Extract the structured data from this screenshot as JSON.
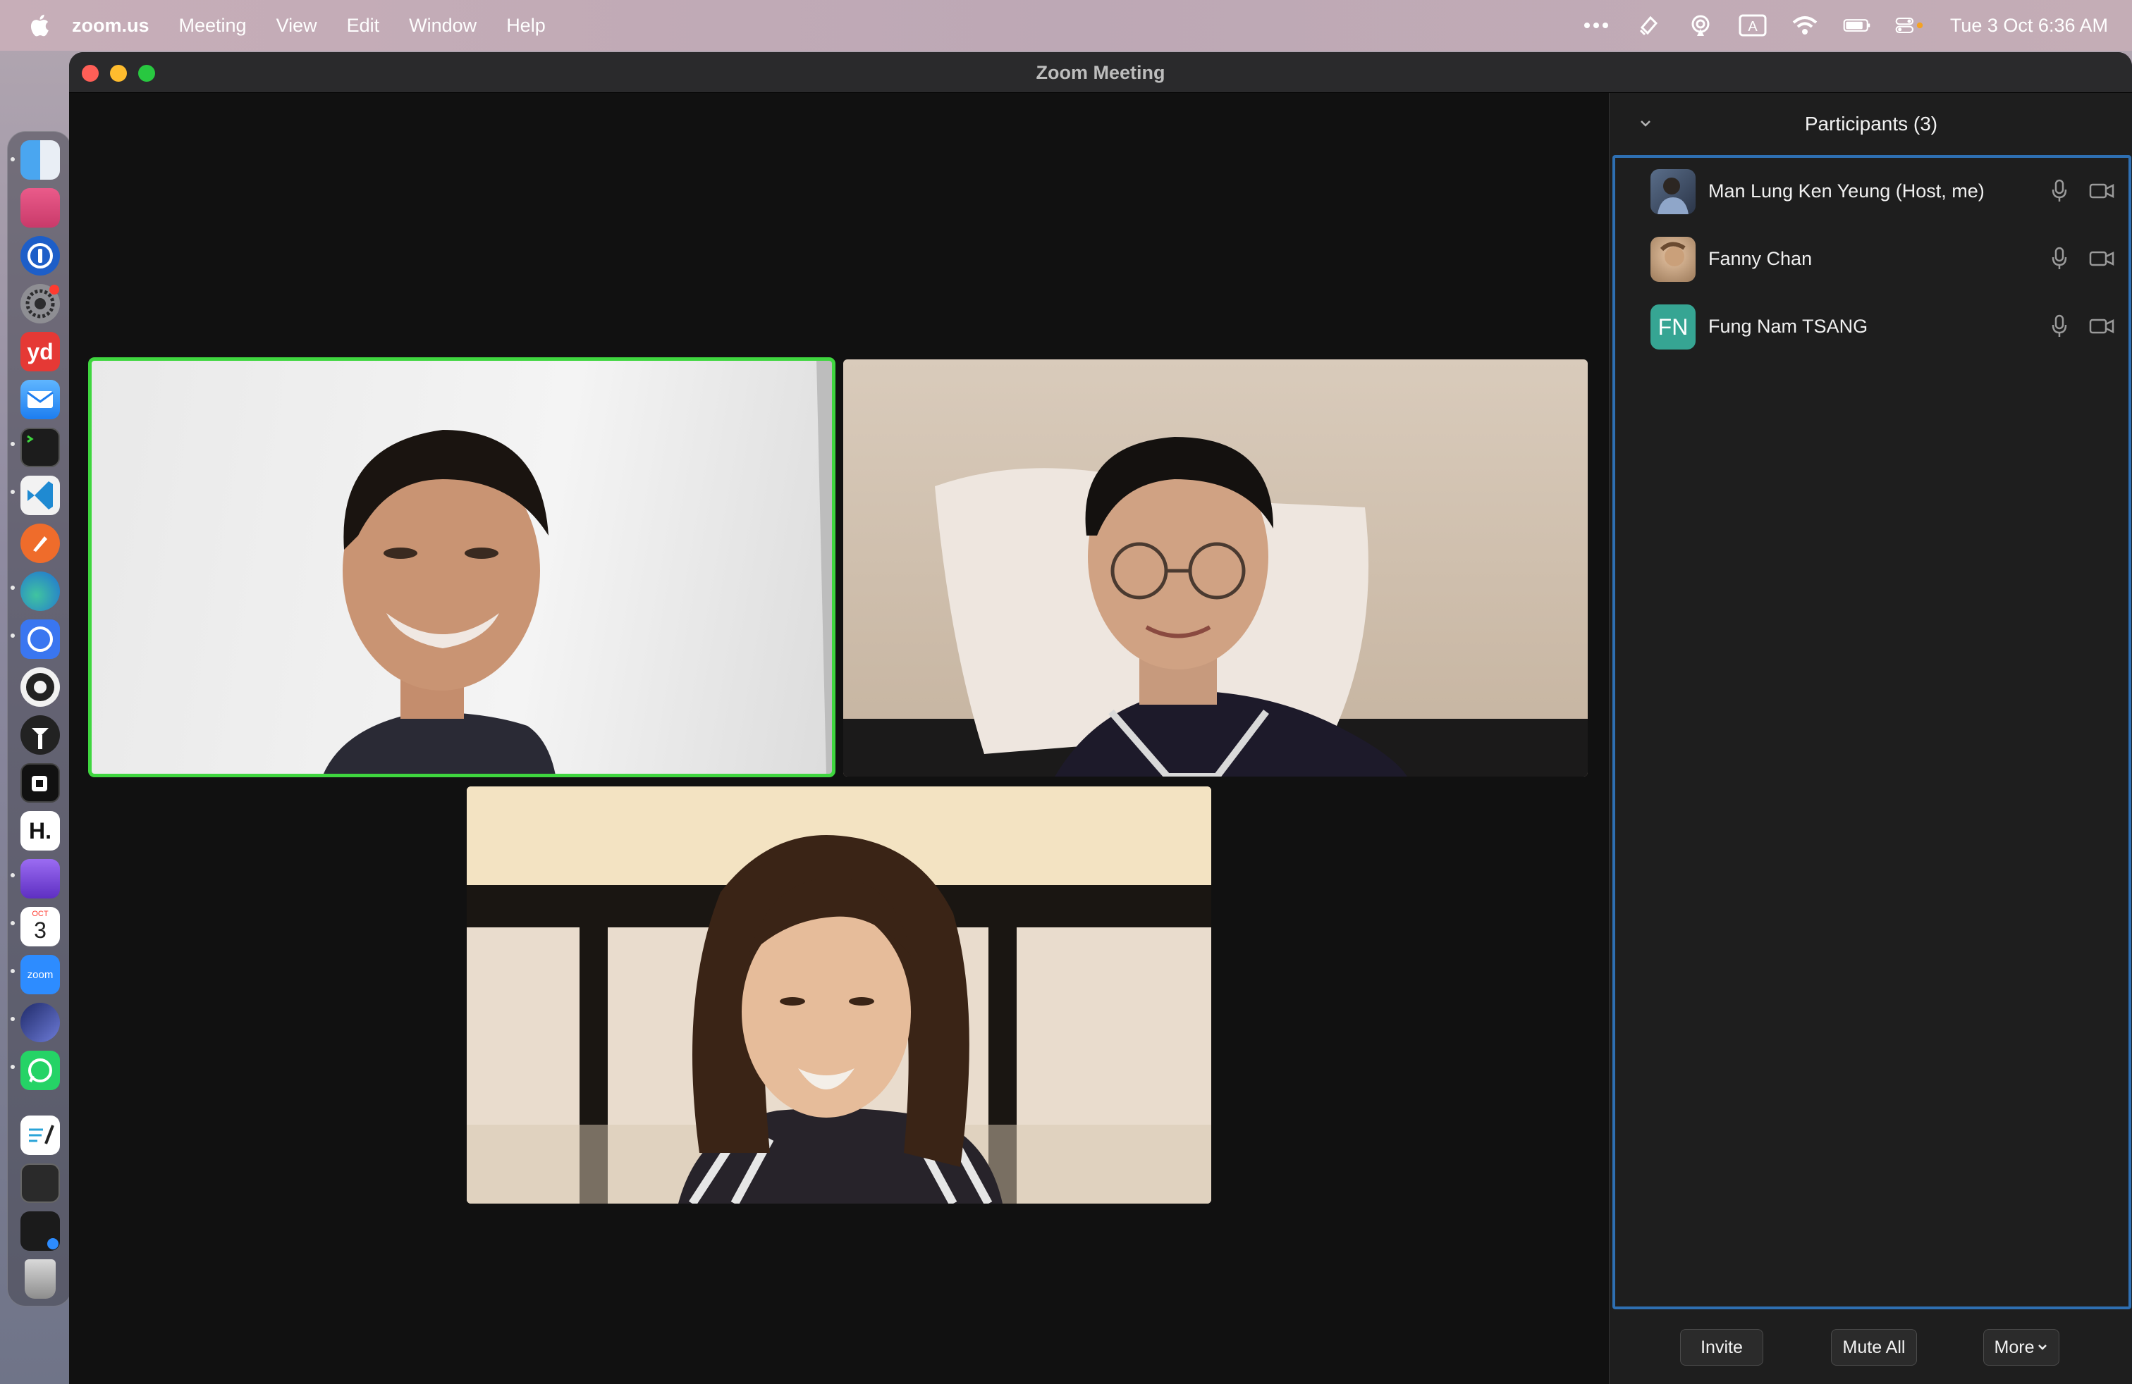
{
  "menubar": {
    "app_name": "zoom.us",
    "menus": [
      "Meeting",
      "View",
      "Edit",
      "Window",
      "Help"
    ],
    "clock": "Tue 3 Oct  6:36 AM"
  },
  "window": {
    "title": "Zoom Meeting"
  },
  "dock": {
    "apps": [
      "finder-icon",
      "photo-booth-icon",
      "1password-icon",
      "system-settings-icon",
      "youdao-icon",
      "mail-icon",
      "terminal-icon",
      "vscode-icon",
      "postman-icon",
      "edge-icon",
      "signal-icon",
      "obs-icon",
      "tailscale-icon",
      "affinity-icon",
      "hashnode-icon",
      "obsidian-icon",
      "calendar-icon",
      "zoom-icon",
      "linear-icon",
      "whatsapp-icon",
      "texteditor-icon",
      "screenshot-icon",
      "recent-window-icon",
      "trash-icon"
    ],
    "calendar_day": "3",
    "calendar_month": "OCT",
    "zoom_label": "zoom",
    "yd_label": "yd",
    "h_label": "H."
  },
  "participants_panel": {
    "title": "Participants (3)",
    "participants": [
      {
        "name": "Man Lung Ken Yeung (Host, me)",
        "avatar": "photo"
      },
      {
        "name": "Fanny Chan",
        "avatar": "photo"
      },
      {
        "name": "Fung Nam TSANG",
        "avatar": "initials",
        "initials": "FN",
        "avatar_color": "#36a593"
      }
    ],
    "buttons": {
      "invite": "Invite",
      "mute_all": "Mute All",
      "more": "More"
    }
  },
  "colors": {
    "active_speaker": "#3fd63f",
    "panel_focus": "#2e6fb2"
  }
}
